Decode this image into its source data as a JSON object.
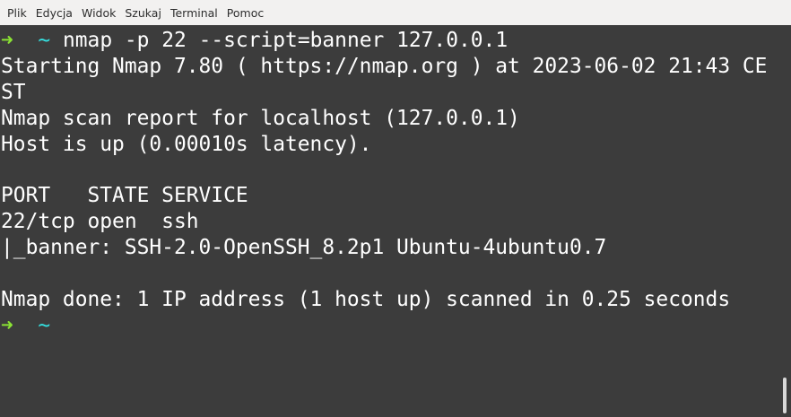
{
  "menu": {
    "items": [
      "Plik",
      "Edycja",
      "Widok",
      "Szukaj",
      "Terminal",
      "Pomoc"
    ]
  },
  "prompt": {
    "arrow": "➜",
    "dir": "~",
    "command": "nmap -p 22 --script=banner 127.0.0.1"
  },
  "output": {
    "line1": "Starting Nmap 7.80 ( https://nmap.org ) at 2023-06-02 21:43 CE",
    "line2": "ST",
    "line3": "Nmap scan report for localhost (127.0.0.1)",
    "line4": "Host is up (0.00010s latency).",
    "line5": "",
    "line6": "PORT   STATE SERVICE",
    "line7": "22/tcp open  ssh",
    "line8": "|_banner: SSH-2.0-OpenSSH_8.2p1 Ubuntu-4ubuntu0.7",
    "line9": "",
    "line10": "Nmap done: 1 IP address (1 host up) scanned in 0.25 seconds"
  },
  "colors": {
    "background": "#3c3c3c",
    "prompt_arrow": "#8ae234",
    "prompt_dir": "#34e2e2",
    "text": "#ffffff"
  }
}
